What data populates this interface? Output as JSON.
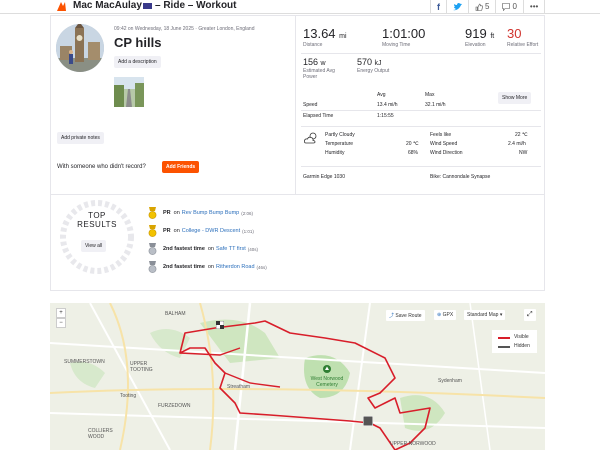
{
  "header": {
    "athlete_name": "Mac MacAulay",
    "activity_type": "– Ride – Workout",
    "kudos_count": "5",
    "comments_count": "0"
  },
  "activity": {
    "meta": "09:42 on Wednesday, 18 June 2025 · Greater London, England",
    "title": "CP hills",
    "add_description": "Add a description",
    "add_private_notes": "Add private notes",
    "record_question": "With someone who didn't record?",
    "add_friends": "Add Friends"
  },
  "stats": {
    "distance": {
      "value": "13.64",
      "unit": "mi",
      "label": "Distance"
    },
    "moving_time": {
      "value": "1:01:00",
      "label": "Moving Time"
    },
    "elevation": {
      "value": "919",
      "unit": "ft",
      "label": "Elevation"
    },
    "relative_effort": {
      "value": "30",
      "label": "Relative Effort"
    },
    "power": {
      "value": "156",
      "unit": "w",
      "label": "Estimated Avg Power"
    },
    "energy": {
      "value": "570",
      "unit": "kJ",
      "label": "Energy Output"
    }
  },
  "details": {
    "col_avg": "Avg",
    "col_max": "Max",
    "speed_label": "Speed",
    "speed_avg": "13.4 mi/h",
    "speed_max": "32.1 mi/h",
    "elapsed_label": "Elapsed Time",
    "elapsed_value": "1:15:55",
    "show_more": "Show More"
  },
  "weather": {
    "condition": "Partly Cloudy",
    "temperature_label": "Temperature",
    "temperature": "20 ℃",
    "humidity_label": "Humidity",
    "humidity": "68%",
    "feels_like_label": "Feels like",
    "feels_like": "22 ℃",
    "wind_speed_label": "Wind Speed",
    "wind_speed": "2.4 mi/h",
    "wind_direction_label": "Wind Direction",
    "wind_direction": "NW"
  },
  "device": {
    "device": "Garmin Edge 1030",
    "bike": "Bike: Cannondale Synapse"
  },
  "results": {
    "top_line1": "TOP",
    "top_line2": "RESULTS",
    "view_all": "View all",
    "items": [
      {
        "rank": "PR",
        "on": "on",
        "segment": "Rev Bump Bump Bump",
        "time": "(2:06)",
        "medal": "gold"
      },
      {
        "rank": "PR",
        "on": "on",
        "segment": "College - DWR Descent",
        "time": "(1:01)",
        "medal": "gold"
      },
      {
        "rank": "2nd fastest time",
        "on": "on",
        "segment": "Safe TT first",
        "time": "(40s)",
        "medal": "silver"
      },
      {
        "rank": "2nd fastest time",
        "on": "on",
        "segment": "Ritherdon Road",
        "time": "(46s)",
        "medal": "silver"
      }
    ]
  },
  "map": {
    "save_route": "Save Route",
    "gpx": "GPX",
    "map_style": "Standard Map",
    "legend_visible": "Visible",
    "legend_hidden": "Hidden",
    "labels": {
      "balham": "BALHAM",
      "summerstown": "SUMMERSTOWN",
      "upper_tooting": "UPPER TOOTING",
      "tooting": "Tooting",
      "furzedown": "FURZEDOWN",
      "streatham": "Streatham",
      "west_norwood": "West Norwood Cemetery",
      "sydenham": "Sydenham",
      "colliers_wood": "COLLIERS WOOD",
      "upper_norwood": "UPPER NORWOOD"
    },
    "route_color": "#d81e2a"
  },
  "colors": {
    "accent": "#fc5200",
    "link": "#2a6ebb",
    "relative_effort": "#d0322d"
  }
}
